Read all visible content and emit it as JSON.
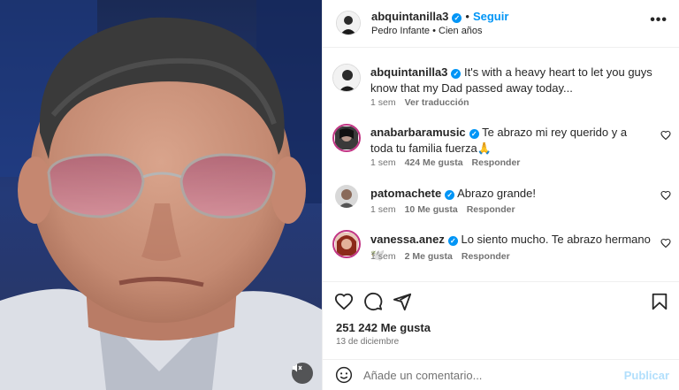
{
  "post": {
    "author": "abquintanilla3",
    "follow_label": "Seguir",
    "audio": "Pedro Infante • Cien años",
    "more_icon": "more-horizontal-icon",
    "caption_user": "abquintanilla3",
    "caption_text": "It's with a heavy heart to let you guys know that my Dad passed away today...",
    "caption_time": "1 sem",
    "caption_translate": "Ver traducción"
  },
  "comments": [
    {
      "user": "anabarbaramusic",
      "text": "Te abrazo mi rey querido y a toda tu familia fuerza🙏",
      "time": "1 sem",
      "likes": "424 Me gusta",
      "reply": "Responder"
    },
    {
      "user": "patomachete",
      "text": "Abrazo grande!",
      "time": "1 sem",
      "likes": "10 Me gusta",
      "reply": "Responder"
    },
    {
      "user": "vanessa.anez",
      "text": "Lo siento mucho. Te abrazo hermano 🕊️",
      "time": "1 sem",
      "likes": "2 Me gusta",
      "reply": "Responder"
    }
  ],
  "stats": {
    "likes": "251 242 Me gusta",
    "date": "13 de diciembre"
  },
  "add_comment": {
    "placeholder": "Añade un comentario...",
    "publish_label": "Publicar"
  },
  "colors": {
    "accent": "#0095f6",
    "publish_disabled": "#b2dffc",
    "muted_text": "#737373"
  }
}
